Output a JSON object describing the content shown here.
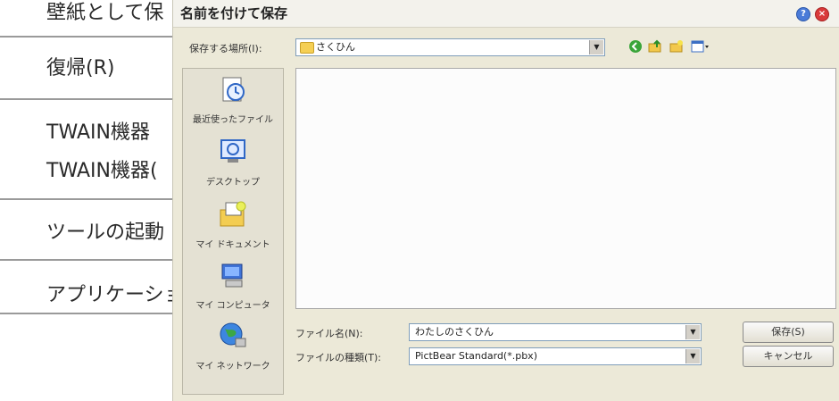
{
  "background_menu": {
    "items": [
      "壁紙として保",
      "復帰(R)",
      "TWAIN機器",
      "TWAIN機器(",
      "ツールの起動",
      "アプリケーショ"
    ]
  },
  "dialog": {
    "title": "名前を付けて保存",
    "save_in_label": "保存する場所(I):",
    "save_in_value": "さくひん",
    "places": [
      {
        "label": "最近使ったファイル",
        "icon": "recent-files-icon"
      },
      {
        "label": "デスクトップ",
        "icon": "desktop-icon"
      },
      {
        "label": "マイ ドキュメント",
        "icon": "my-documents-icon"
      },
      {
        "label": "マイ コンピュータ",
        "icon": "my-computer-icon"
      },
      {
        "label": "マイ ネットワーク",
        "icon": "my-network-icon"
      }
    ],
    "filename_label": "ファイル名(N):",
    "filename_value": "わたしのさくひん",
    "filetype_label": "ファイルの種類(T):",
    "filetype_value": "PictBear Standard(*.pbx)",
    "save_button": "保存(S)",
    "cancel_button": "キャンセル"
  }
}
